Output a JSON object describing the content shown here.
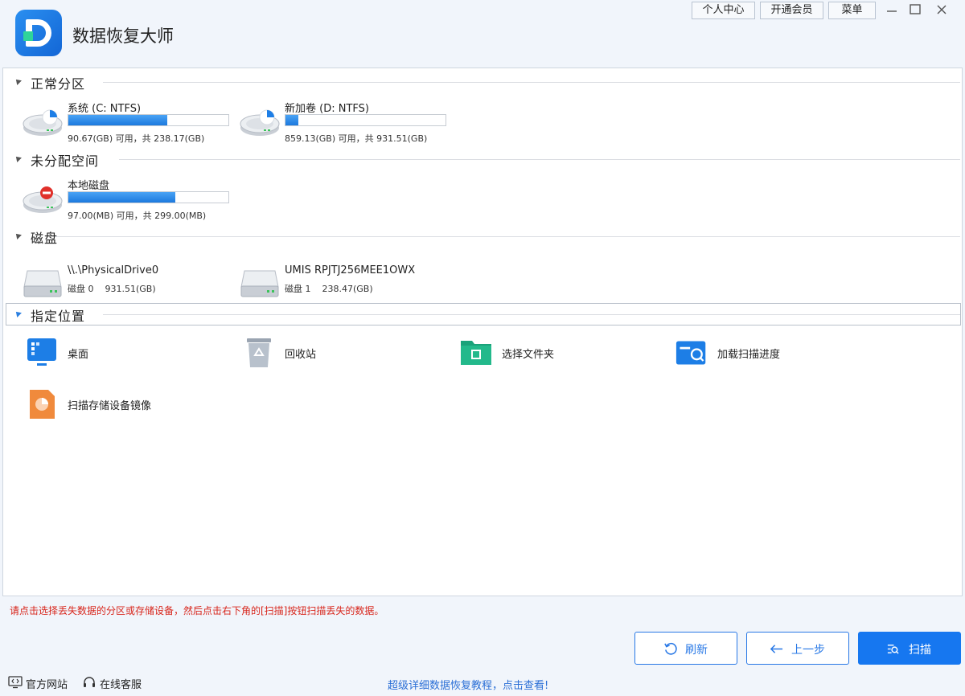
{
  "app": {
    "title": "数据恢复大师"
  },
  "topbar": {
    "personal": "个人中心",
    "member": "开通会员",
    "menu": "菜单"
  },
  "sections": {
    "normal": "正常分区",
    "unallocated": "未分配空间",
    "disks": "磁盘",
    "locations": "指定位置"
  },
  "partitions": [
    {
      "name": "系统 (C: NTFS)",
      "info": "90.67(GB) 可用，共 238.17(GB)",
      "used_fraction": 0.62
    },
    {
      "name": "新加卷 (D: NTFS)",
      "info": "859.13(GB) 可用，共 931.51(GB)",
      "used_fraction": 0.08
    }
  ],
  "unallocated": [
    {
      "name": "本地磁盘",
      "info": "97.00(MB) 可用，共 299.00(MB)",
      "used_fraction": 0.67
    }
  ],
  "disks": [
    {
      "name": "\\\\.\\PhysicalDrive0",
      "index": "磁盘 0",
      "size": "931.51(GB)"
    },
    {
      "name": "UMIS RPJTJ256MEE1OWX",
      "index": "磁盘 1",
      "size": "238.47(GB)"
    }
  ],
  "locations": [
    {
      "label": "桌面",
      "icon": "desktop-icon"
    },
    {
      "label": "回收站",
      "icon": "recycle-bin-icon"
    },
    {
      "label": "选择文件夹",
      "icon": "folder-icon"
    },
    {
      "label": "加载扫描进度",
      "icon": "load-progress-icon"
    },
    {
      "label": "扫描存储设备镜像",
      "icon": "disk-image-icon"
    }
  ],
  "hint": "请点击选择丢失数据的分区或存储设备，然后点击右下角的[扫描]按钮扫描丢失的数据。",
  "buttons": {
    "refresh": "刷新",
    "back": "上一步",
    "scan": "扫描"
  },
  "footer": {
    "website": "官方网站",
    "support": "在线客服",
    "tutorial": "超级详细数据恢复教程，点击查看!"
  },
  "colors": {
    "accent": "#1677f0",
    "hint": "#d8251b",
    "bar": "#1c79dd"
  }
}
